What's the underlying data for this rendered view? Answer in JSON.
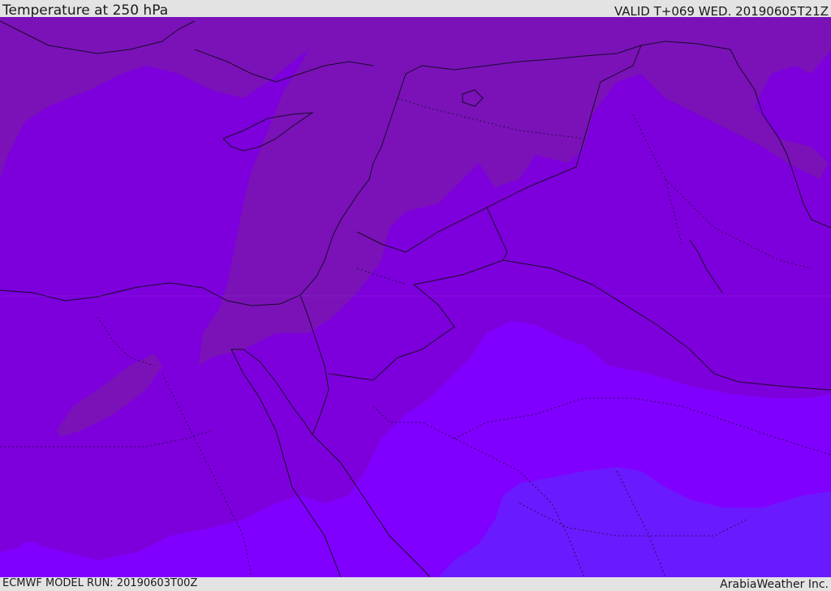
{
  "header": {
    "title": "Temperature at 250 hPa",
    "valid": "VALID T+069 WED. 20190605T21Z"
  },
  "footer": {
    "model_run": "ECMWF MODEL RUN: 20190603T00Z",
    "credit": "ArabiaWeather Inc."
  },
  "colors": {
    "frame": "#e3e3e3",
    "dark_band": "#7a12b8",
    "main_band": "#7d00dc",
    "light_band": "#8000ff",
    "blue_band": "#6a1aff",
    "border_line": "#1a0a2a"
  }
}
